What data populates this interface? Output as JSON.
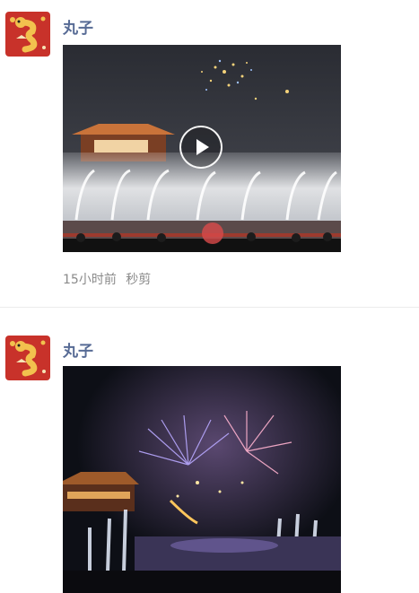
{
  "posts": [
    {
      "author": "丸子",
      "avatar_icon": "zodiac-snake-avatar-icon",
      "media_type": "video",
      "media_description_icon": "fireworks-fountain-show-image",
      "time": "15小时前",
      "source": "秒剪"
    },
    {
      "author": "丸子",
      "avatar_icon": "zodiac-snake-avatar-icon",
      "media_type": "photo",
      "media_description_icon": "fireworks-fountain-show-image"
    }
  ],
  "colors": {
    "nickname": "#576b95",
    "meta_text": "#8a8a8a",
    "avatar_bg": "#c8322a",
    "divider": "#ececec"
  }
}
